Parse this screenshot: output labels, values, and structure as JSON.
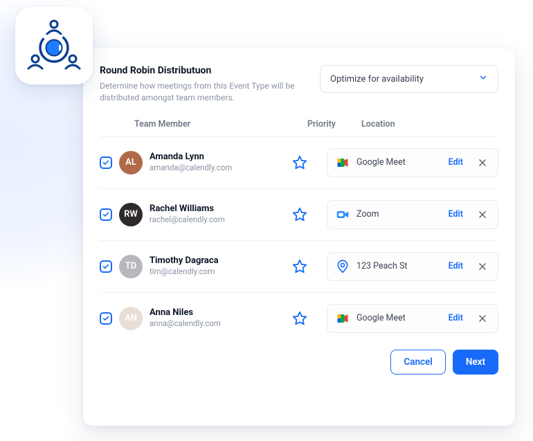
{
  "header": {
    "title": "Round Robin Distributuon",
    "description": "Determine how meetings from this Event Type will be distributed amongst team members.",
    "select_label": "Optimize for availability"
  },
  "columns": {
    "member": "Team Member",
    "priority": "Priority",
    "location": "Location"
  },
  "labels": {
    "edit": "Edit"
  },
  "members": [
    {
      "name": "Amanda Lynn",
      "email": "amanda@calendly.com",
      "checked": true,
      "location": {
        "kind": "google-meet",
        "text": "Google Meet"
      },
      "avatar": {
        "initials": "AL",
        "bg": "#b06a4a"
      }
    },
    {
      "name": "Rachel Williams",
      "email": "rachel@calendly.com",
      "checked": true,
      "location": {
        "kind": "zoom",
        "text": "Zoom"
      },
      "avatar": {
        "initials": "RW",
        "bg": "#2f2a2a"
      }
    },
    {
      "name": "Timothy Dagraca",
      "email": "tim@calendly.com",
      "checked": true,
      "location": {
        "kind": "address",
        "text": "123 Peach St"
      },
      "avatar": {
        "initials": "TD",
        "bg": "#b6b8bd"
      }
    },
    {
      "name": "Anna Niles",
      "email": "anna@calendly.com",
      "checked": true,
      "location": {
        "kind": "google-meet",
        "text": "Google Meet"
      },
      "avatar": {
        "initials": "AN",
        "bg": "#e8ded4"
      }
    }
  ],
  "footer": {
    "cancel": "Cancel",
    "next": "Next"
  }
}
